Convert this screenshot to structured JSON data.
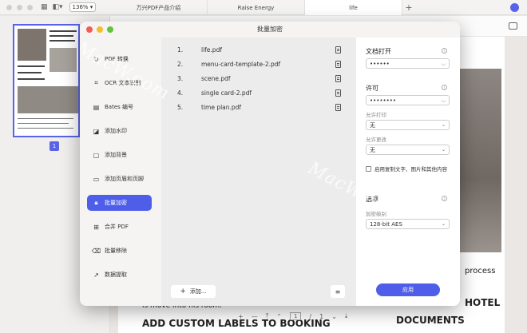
{
  "topbar": {
    "zoom": "136%",
    "tabs": [
      "万兴PDF产品介绍",
      "Raise Energy",
      "life"
    ],
    "add_tab": "+"
  },
  "sidebar": {
    "page_number": "1"
  },
  "document": {
    "text_process": "process",
    "text_room": "is move into his room.",
    "text_labels": "ADD CUSTOM LABELS TO BOOKING",
    "text_hotel": "HOTEL",
    "text_documents": "DOCUMENTS"
  },
  "pagenav": {
    "plus": "+",
    "minus": "—",
    "current": "1",
    "sep": "/",
    "total": "1"
  },
  "dialog": {
    "title": "批量加密",
    "menu": [
      {
        "label": "PDF 转换",
        "icon": "convert-icon"
      },
      {
        "label": "OCR 文本识别",
        "icon": "ocr-icon"
      },
      {
        "label": "Bates 编号",
        "icon": "bates-icon"
      },
      {
        "label": "添加水印",
        "icon": "watermark-icon"
      },
      {
        "label": "添加背景",
        "icon": "background-icon"
      },
      {
        "label": "添加页眉和页脚",
        "icon": "header-footer-icon"
      },
      {
        "label": "批量加密",
        "icon": "lock-icon"
      },
      {
        "label": "合并 PDF",
        "icon": "merge-icon"
      },
      {
        "label": "批量移除",
        "icon": "trash-icon"
      },
      {
        "label": "数据提取",
        "icon": "extract-icon"
      }
    ],
    "files": [
      {
        "num": "1.",
        "name": "life.pdf"
      },
      {
        "num": "2.",
        "name": "menu-card-template-2.pdf"
      },
      {
        "num": "3.",
        "name": "scene.pdf"
      },
      {
        "num": "4.",
        "name": "single card-2.pdf"
      },
      {
        "num": "5.",
        "name": "time plan.pdf"
      }
    ],
    "add_button": "添加...",
    "options": {
      "open_label": "文档打开",
      "open_password": "••••••",
      "permission_label": "许可",
      "permission_password": "••••••••",
      "print_label": "允许打印",
      "print_value": "无",
      "change_label": "允许更改",
      "change_value": "无",
      "copy_checkbox": "启用复制文字、图片和其他内容",
      "options_label": "选项",
      "encryption_label": "加密级别",
      "encryption_value": "128-bit AES"
    },
    "apply_button": "应用"
  },
  "watermark_text": "MacW.com",
  "colors": {
    "accent": "#4f5ee9"
  }
}
